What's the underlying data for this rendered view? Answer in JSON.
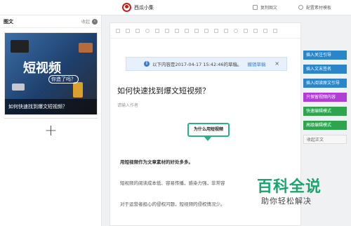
{
  "header": {
    "app_name": "西瓜小集",
    "actions": [
      {
        "label": "复制图文",
        "icon": "copy-icon"
      },
      {
        "label": "配置素材模板",
        "icon": "settings-icon"
      }
    ]
  },
  "sidebar": {
    "title": "图文",
    "collapse_label": "收起",
    "card": {
      "image_title": "短视频",
      "image_subtitle": "你造了吗？",
      "caption": "如何快速找到爆文短视频？"
    },
    "add_label": "+"
  },
  "notice": {
    "text": "以下内容是2017-04-17 15:42:46的草稿。",
    "undo_label": "撤销草稿",
    "close_label": "×"
  },
  "article": {
    "title": "如何快速找到爆文短视频？",
    "author_placeholder": "请输入作者",
    "callout": "为什么用短视频",
    "paragraphs": [
      "用短视频作为文章素材的好处多多。",
      "短视频的阅读成本低、容易传播，感染力强，非常容",
      "对于运营者担心的侵权问题，短视频的侵权情况少。"
    ]
  },
  "right_actions": [
    {
      "label": "插入关注引导",
      "style": "blue"
    },
    {
      "label": "插入文末签名",
      "style": "blue"
    },
    {
      "label": "插入阅读原文引导",
      "style": "blue"
    },
    {
      "label": "只保留视频内容",
      "style": "purple"
    },
    {
      "label": "快速编辑模式",
      "style": "green"
    },
    {
      "label": "高级编辑模式",
      "style": "green"
    },
    {
      "label": "收起正文",
      "style": "ghost"
    }
  ],
  "watermark": {
    "title": "百科全说",
    "subtitle": "助你轻松解决"
  },
  "colors": {
    "blue": "#2a86c9",
    "purple": "#b23cd6",
    "green": "#2fa44f",
    "callout_border": "#27b08a",
    "brand_red": "#c81e1e"
  }
}
